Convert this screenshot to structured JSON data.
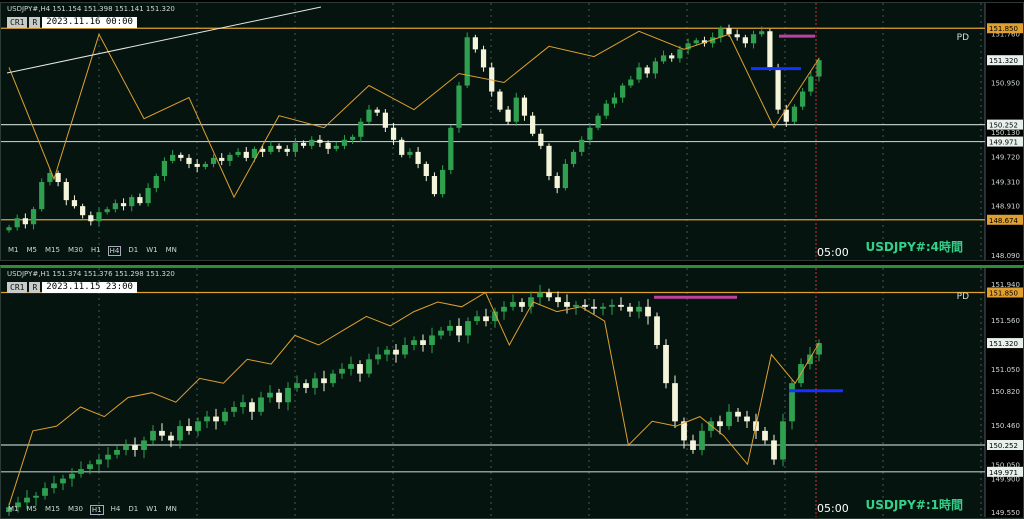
{
  "panel1": {
    "info": "USDJPY#,H4  151.154 151.398 151.141 151.320",
    "cr": "CR1",
    "r": "R",
    "date": "2023.11.16 00:00",
    "pd": "PD",
    "tag": "USDJPY#:4時間",
    "time": "05:00",
    "timeframes": [
      "M1",
      "M5",
      "M15",
      "M30",
      "H1",
      "H4",
      "D1",
      "W1",
      "MN"
    ],
    "active_tf": "H4"
  },
  "panel2": {
    "info": "USDJPY#,H1  151.374 151.376 151.298 151.320",
    "cr": "CR1",
    "r": "R",
    "date": "2023.11.15 23:00",
    "pd": "PD",
    "tag": "USDJPY#:1時間",
    "time": "05:00",
    "timeframes": [
      "M1",
      "M5",
      "M15",
      "M30",
      "H1",
      "H4",
      "D1",
      "W1",
      "MN"
    ],
    "active_tf": "H1"
  },
  "colors": {
    "bg": "#05140f",
    "bull": "#2fa050",
    "bear": "#f5f5dc",
    "orange": "#e0a030",
    "white_line": "#b8c4c0",
    "magenta": "#c040a0",
    "blue": "#1830ff",
    "red": "#d03030"
  },
  "chart_data": [
    {
      "type": "candlestick",
      "title": "USDJPY#,H4",
      "ylim": [
        148.09,
        151.97
      ],
      "yticks": [
        151.76,
        151.32,
        150.95,
        150.13,
        149.72,
        149.31,
        148.91,
        148.09
      ],
      "hlines": [
        {
          "value": 151.85,
          "label": "151.850",
          "color": "#e0a030",
          "label_bg": "#e0a030"
        },
        {
          "value": 150.252,
          "label": "150.252",
          "color": "#b8c4c0",
          "label_bg": "#e8f0ec"
        },
        {
          "value": 149.971,
          "label": "149.971",
          "color": "#b8c4c0",
          "label_bg": "#e8f0ec"
        },
        {
          "value": 148.674,
          "label": "148.674",
          "color": "#e0a030",
          "label_bg": "#e0a030"
        }
      ],
      "price_label": "151.320",
      "zigzag": [
        151.2,
        149.35,
        151.75,
        150.35,
        150.7,
        149.05,
        150.4,
        150.2,
        150.9,
        150.5,
        151.1,
        150.95,
        151.55,
        151.38,
        151.8,
        151.5,
        151.75,
        150.2,
        151.35
      ],
      "pd_level": 151.72,
      "blue_level": 151.18,
      "closes": [
        148.55,
        148.7,
        148.6,
        148.85,
        149.3,
        149.45,
        149.3,
        149.0,
        148.9,
        148.75,
        148.65,
        148.8,
        148.85,
        148.95,
        148.9,
        149.05,
        148.95,
        149.2,
        149.4,
        149.65,
        149.75,
        149.7,
        149.6,
        149.55,
        149.6,
        149.7,
        149.65,
        149.75,
        149.8,
        149.7,
        149.85,
        149.8,
        149.9,
        149.85,
        149.8,
        149.95,
        149.9,
        150.0,
        149.95,
        149.85,
        149.9,
        150.0,
        150.05,
        150.3,
        150.5,
        150.45,
        150.2,
        150.0,
        149.75,
        149.8,
        149.6,
        149.4,
        149.1,
        149.5,
        150.2,
        150.9,
        151.7,
        151.5,
        151.2,
        150.8,
        150.5,
        150.3,
        150.7,
        150.4,
        150.1,
        149.9,
        149.4,
        149.2,
        149.6,
        149.8,
        150.0,
        150.2,
        150.4,
        150.6,
        150.7,
        150.9,
        151.0,
        151.2,
        151.1,
        151.3,
        151.4,
        151.35,
        151.5,
        151.6,
        151.65,
        151.6,
        151.7,
        151.85,
        151.75,
        151.7,
        151.6,
        151.75,
        151.8,
        151.2,
        150.5,
        150.3,
        150.55,
        150.8,
        151.05,
        151.32
      ]
    },
    {
      "type": "candlestick",
      "title": "USDJPY#,H1",
      "ylim": [
        149.55,
        151.96
      ],
      "yticks": [
        151.94,
        151.56,
        151.05,
        150.82,
        150.46,
        150.05,
        149.9,
        149.55
      ],
      "hlines": [
        {
          "value": 151.85,
          "label": "151.850",
          "color": "#e0a030",
          "label_bg": "#e0a030"
        },
        {
          "value": 150.252,
          "label": "150.252",
          "color": "#b8c4c0",
          "label_bg": "#e8f0ec"
        },
        {
          "value": 149.971,
          "label": "149.971",
          "color": "#b8c4c0",
          "label_bg": "#e8f0ec"
        }
      ],
      "price_label": "151.320",
      "zigzag": [
        149.62,
        150.4,
        150.45,
        150.65,
        150.55,
        150.75,
        150.8,
        150.7,
        150.95,
        150.9,
        151.15,
        151.1,
        151.4,
        151.3,
        151.45,
        151.6,
        151.5,
        151.65,
        151.75,
        151.7,
        151.85,
        151.3,
        151.75,
        151.65,
        151.7,
        151.55,
        150.25,
        150.5,
        150.45,
        150.55,
        150.35,
        150.05,
        151.2,
        150.9,
        151.32
      ],
      "pd_level": 151.8,
      "blue_level": 150.82,
      "closes": [
        149.6,
        149.65,
        149.7,
        149.72,
        149.8,
        149.85,
        149.9,
        149.95,
        150.0,
        150.05,
        150.1,
        150.15,
        150.2,
        150.25,
        150.2,
        150.3,
        150.4,
        150.35,
        150.3,
        150.45,
        150.4,
        150.5,
        150.55,
        150.5,
        150.6,
        150.65,
        150.7,
        150.6,
        150.75,
        150.8,
        150.7,
        150.85,
        150.9,
        150.85,
        150.95,
        150.9,
        151.0,
        151.05,
        151.1,
        151.0,
        151.15,
        151.2,
        151.25,
        151.2,
        151.3,
        151.35,
        151.3,
        151.4,
        151.45,
        151.5,
        151.4,
        151.55,
        151.6,
        151.55,
        151.65,
        151.7,
        151.75,
        151.7,
        151.8,
        151.85,
        151.8,
        151.75,
        151.7,
        151.72,
        151.7,
        151.68,
        151.7,
        151.72,
        151.7,
        151.65,
        151.7,
        151.6,
        151.3,
        150.9,
        150.5,
        150.3,
        150.2,
        150.4,
        150.5,
        150.45,
        150.6,
        150.55,
        150.5,
        150.4,
        150.3,
        150.1,
        150.5,
        150.9,
        151.1,
        151.2,
        151.32
      ]
    }
  ]
}
